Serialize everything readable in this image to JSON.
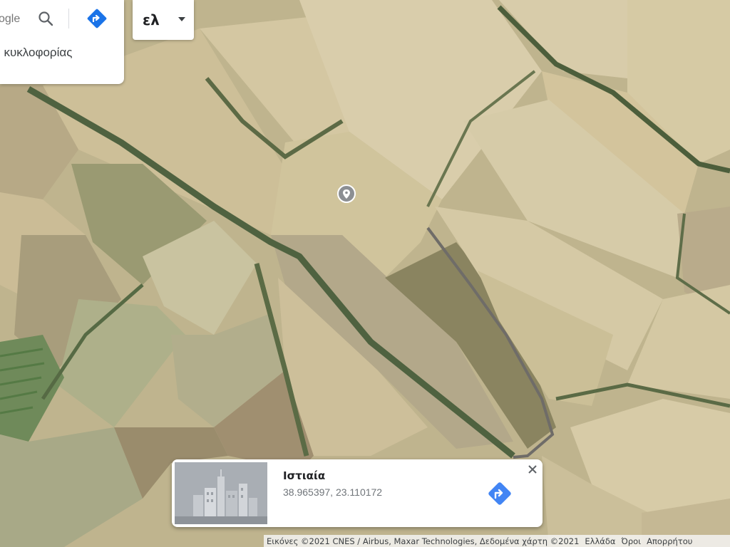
{
  "search": {
    "placeholder_fragment": "ogle",
    "search_icon": "search-icon",
    "directions_icon": "directions-icon",
    "traffic_text": ", κυκλοφορίας"
  },
  "language": {
    "label": "ελ",
    "caret_icon": "caret-down-icon"
  },
  "map": {
    "view": "satellite",
    "marker_icon": "place-pin-icon"
  },
  "info_card": {
    "title": "Ιστιαία",
    "coordinates": "38.965397, 23.110172",
    "directions_icon": "directions-icon",
    "close_icon": "close-icon",
    "accent_color": "#4285f4"
  },
  "attribution": {
    "imagery": "Εικόνες ©2021 CNES / Airbus, Maxar Technologies, Δεδομένα χάρτη ©2021",
    "region": "Ελλάδα",
    "terms": "Όροι",
    "privacy": "Απορρήτου"
  }
}
